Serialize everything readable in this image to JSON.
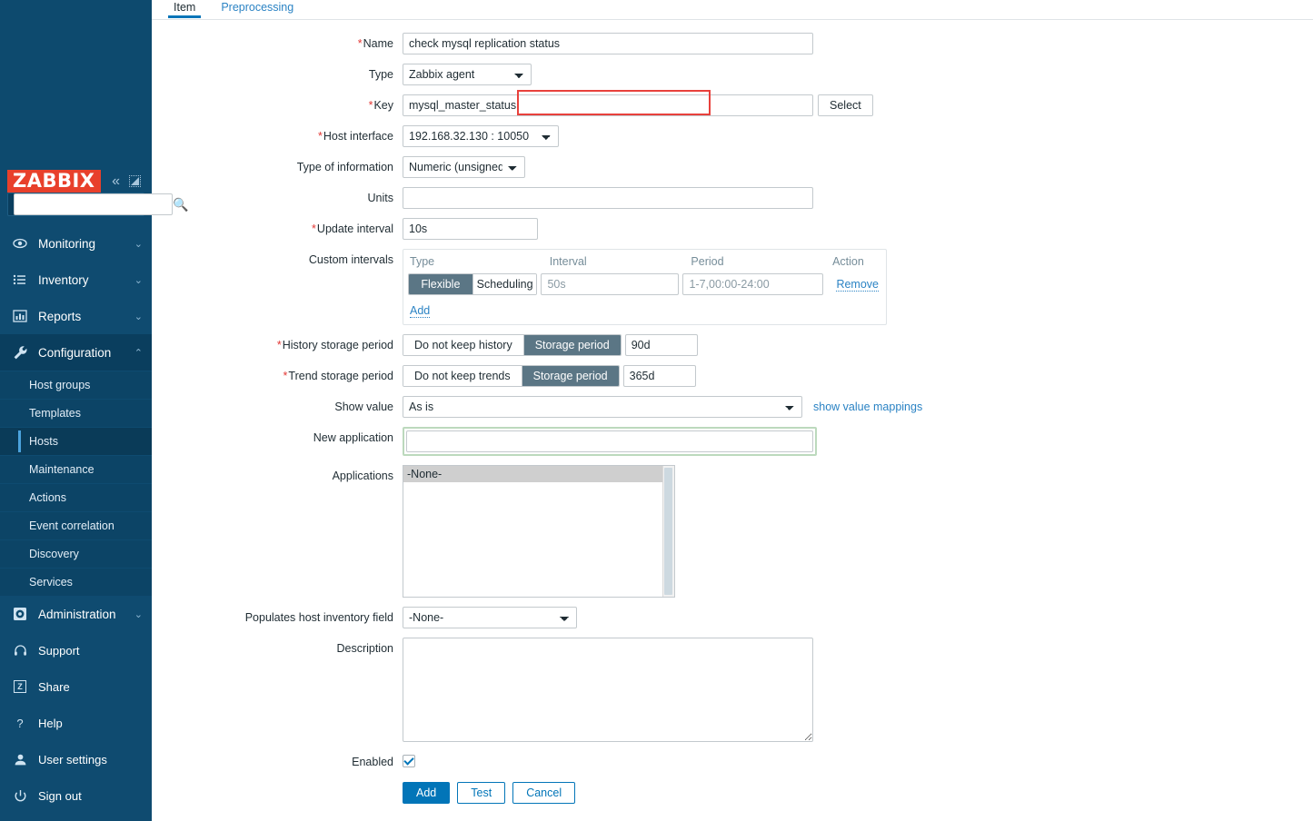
{
  "brand": {
    "logo_text": "ZABBIX",
    "logo_bg": "#e8402b",
    "sidebar_bg": "#0d4a6e",
    "accent": "#0275b8"
  },
  "sidebar": {
    "search_placeholder": "",
    "search_value": "",
    "nav": [
      {
        "label": "Monitoring",
        "icon": "eye-icon",
        "caret": "⌄",
        "active": false
      },
      {
        "label": "Inventory",
        "icon": "list-icon",
        "caret": "⌄",
        "active": false
      },
      {
        "label": "Reports",
        "icon": "bar-chart-icon",
        "caret": "⌄",
        "active": false
      },
      {
        "label": "Configuration",
        "icon": "wrench-icon",
        "caret": "⌃",
        "active": true
      },
      {
        "label": "Administration",
        "icon": "gear-icon",
        "caret": "⌄",
        "active": false
      }
    ],
    "configuration_sub": [
      {
        "label": "Host groups",
        "selected": false
      },
      {
        "label": "Templates",
        "selected": false
      },
      {
        "label": "Hosts",
        "selected": true
      },
      {
        "label": "Maintenance",
        "selected": false
      },
      {
        "label": "Actions",
        "selected": false
      },
      {
        "label": "Event correlation",
        "selected": false
      },
      {
        "label": "Discovery",
        "selected": false
      },
      {
        "label": "Services",
        "selected": false
      }
    ],
    "bottom": [
      {
        "label": "Support",
        "icon": "headset-icon"
      },
      {
        "label": "Share",
        "icon": "share-z-icon"
      },
      {
        "label": "Help",
        "icon": "question-icon"
      },
      {
        "label": "User settings",
        "icon": "user-icon"
      },
      {
        "label": "Sign out",
        "icon": "power-icon"
      }
    ]
  },
  "tabs": [
    {
      "label": "Item",
      "active": true
    },
    {
      "label": "Preprocessing",
      "active": false
    }
  ],
  "form": {
    "name": {
      "label": "Name",
      "required": true,
      "value": "check mysql replication status"
    },
    "type": {
      "label": "Type",
      "required": false,
      "value": "Zabbix agent"
    },
    "key": {
      "label": "Key",
      "required": true,
      "value": "mysql_master_status",
      "select_button": "Select",
      "highlighted": true,
      "highlight_color": "#e8413c"
    },
    "host_interface": {
      "label": "Host interface",
      "required": true,
      "value": "192.168.32.130 : 10050"
    },
    "type_of_information": {
      "label": "Type of information",
      "required": false,
      "value": "Numeric (unsigned)"
    },
    "units": {
      "label": "Units",
      "required": false,
      "value": "",
      "placeholder": ""
    },
    "update_interval": {
      "label": "Update interval",
      "required": true,
      "value": "10s"
    },
    "custom_intervals": {
      "label": "Custom intervals",
      "headers": [
        "Type",
        "Interval",
        "Period",
        "Action"
      ],
      "rows": [
        {
          "type_options": [
            "Flexible",
            "Scheduling"
          ],
          "type_selected": "Flexible",
          "interval_value": "",
          "interval_placeholder": "50s",
          "period_value": "",
          "period_placeholder": "1-7,00:00-24:00",
          "action": "Remove"
        }
      ],
      "add_link": "Add"
    },
    "history_storage_period": {
      "label": "History storage period",
      "required": true,
      "options": [
        "Do not keep history",
        "Storage period"
      ],
      "selected": "Storage period",
      "value": "90d"
    },
    "trend_storage_period": {
      "label": "Trend storage period",
      "required": true,
      "options": [
        "Do not keep trends",
        "Storage period"
      ],
      "selected": "Storage period",
      "value": "365d"
    },
    "show_value": {
      "label": "Show value",
      "value": "As is",
      "link": "show value mappings"
    },
    "new_application": {
      "label": "New application",
      "value": "",
      "placeholder": "",
      "focused": true,
      "focus_color": "#bcd9bd"
    },
    "applications": {
      "label": "Applications",
      "options": [
        "-None-"
      ],
      "selected": "-None-"
    },
    "populates_host_inventory_field": {
      "label": "Populates host inventory field",
      "value": "-None-"
    },
    "description": {
      "label": "Description",
      "value": "",
      "placeholder": ""
    },
    "enabled": {
      "label": "Enabled",
      "checked": true
    }
  },
  "buttons": {
    "add": "Add",
    "test": "Test",
    "cancel": "Cancel"
  }
}
